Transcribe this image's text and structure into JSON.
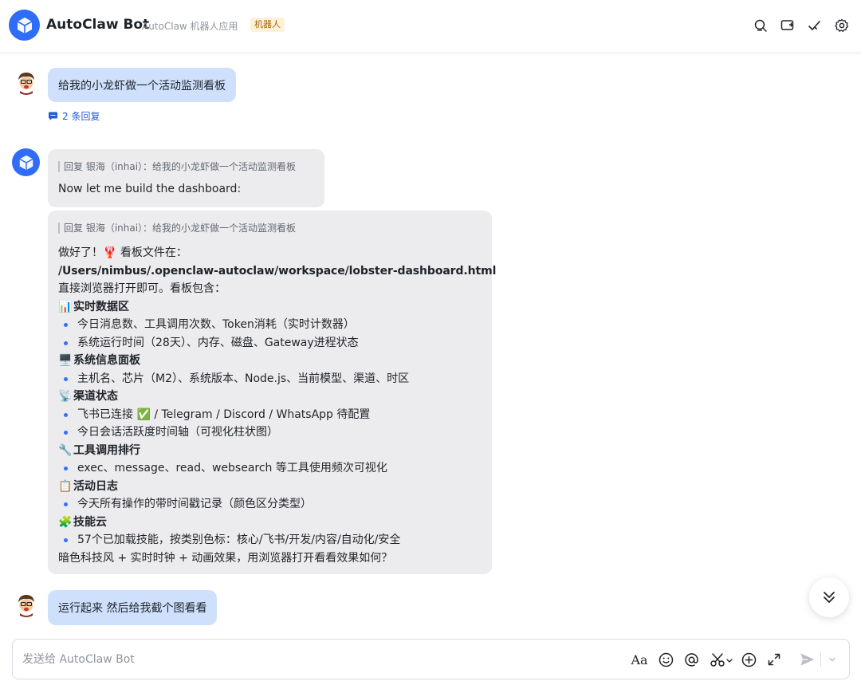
{
  "header": {
    "title": "AutoClaw Bot",
    "subtitle": "AutoClaw 机器人应用",
    "badge": "机器人",
    "icons": [
      "search-icon",
      "add-chat-icon",
      "done-icon",
      "settings-icon"
    ]
  },
  "messages": {
    "user1": {
      "text": "给我的小龙虾做一个活动监测看板",
      "replies": "2 条回复"
    },
    "bot1": {
      "quote": "回复 银海（inhai）：给我的小龙虾做一个活动监测看板",
      "text": "Now let me build the dashboard:"
    },
    "bot2": {
      "quote": "回复 银海（inhai）：给我的小龙虾做一个活动监测看板",
      "lines": [
        "做好了！🦞 看板文件在：",
        "/Users/nimbus/.openclaw-autoclaw/workspace/lobster-dashboard.html",
        "直接浏览器打开即可。看板包含：",
        "实时数据区",
        "今日消息数、工具调用次数、Token消耗（实时计数器）",
        "系统运行时间（28天）、内存、磁盘、Gateway进程状态",
        "系统信息面板",
        "主机名、芯片（M2）、系统版本、Node.js、当前模型、渠道、时区",
        "渠道状态",
        "飞书已连接 ✅ / Telegram / Discord / WhatsApp 待配置",
        "今日会话活跃度时间轴（可视化柱状图）",
        "工具调用排行",
        "exec、message、read、websearch 等工具使用频次可视化",
        "活动日志",
        "今天所有操作的带时间戳记录（颜色区分类型）",
        "技能云",
        "57个已加载技能，按类别色标：核心/飞书/开发/内容/自动化/安全",
        "暗色科技风 + 实时时钟 + 动画效果，用浏览器打开看看效果如何？"
      ],
      "section_emojis": [
        "📊",
        "🖥️",
        "📡",
        "🔧",
        "📋",
        "🧩"
      ]
    },
    "user2": {
      "text": "运行起来 然后给我截个图看看"
    }
  },
  "composer": {
    "placeholder": "发送给 AutoClaw Bot",
    "font_label": "Aa"
  },
  "colors": {
    "accent": "#2f6df6",
    "user_bubble": "#cfe0fd",
    "bot_bubble": "#ececee",
    "bullet": "#3370ff"
  }
}
